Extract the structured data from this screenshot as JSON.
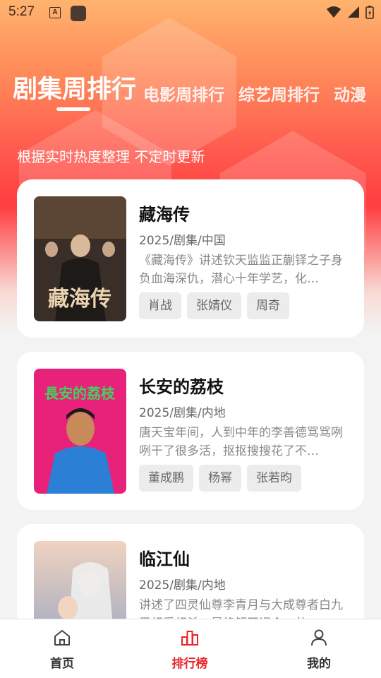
{
  "status_bar": {
    "time": "5:27",
    "keyboard_badge": "A"
  },
  "tabs": [
    {
      "label": "剧集周排行",
      "active": true
    },
    {
      "label": "电影周排行",
      "active": false
    },
    {
      "label": "综艺周排行",
      "active": false
    },
    {
      "label": "动漫",
      "active": false
    }
  ],
  "subtitle": "根据实时热度整理 不定时更新",
  "items": [
    {
      "title": "藏海传",
      "meta": "2025/剧集/中国",
      "desc": "《藏海传》讲述钦天监监正蒯铎之子身负血海深仇，潜心十年学艺，化…",
      "tags": [
        "肖战",
        "张婧仪",
        "周奇"
      ]
    },
    {
      "title": "长安的荔枝",
      "meta": "2025/剧集/内地",
      "desc": "唐天宝年间，人到中年的李善德骂骂咧咧干了很多活，抠抠搜搜花了不…",
      "tags": [
        "董成鹏",
        "杨幂",
        "张若昀"
      ]
    },
    {
      "title": "临江仙",
      "meta": "2025/剧集/内地",
      "desc": "讲述了四灵仙尊李青月与大成尊者白九思相爱相杀，最终解开误会，共…",
      "tags": []
    }
  ],
  "posters": [
    {
      "text": "藏海传",
      "bg": "#3a2f28",
      "fg": "#e9d3b0"
    },
    {
      "text": "長安的荔枝",
      "bg": "#e8217a",
      "fg": "#3fd45a"
    },
    {
      "text": "",
      "bg": "#c7b9c9",
      "fg": "#ffffff"
    }
  ],
  "bottom_nav": [
    {
      "label": "首页",
      "icon": "home-icon",
      "active": false
    },
    {
      "label": "排行榜",
      "icon": "ranking-icon",
      "active": true
    },
    {
      "label": "我的",
      "icon": "user-icon",
      "active": false
    }
  ],
  "colors": {
    "accent": "#e8232a",
    "hero_top": "#ffb36e",
    "hero_mid": "#ff3d3f"
  }
}
